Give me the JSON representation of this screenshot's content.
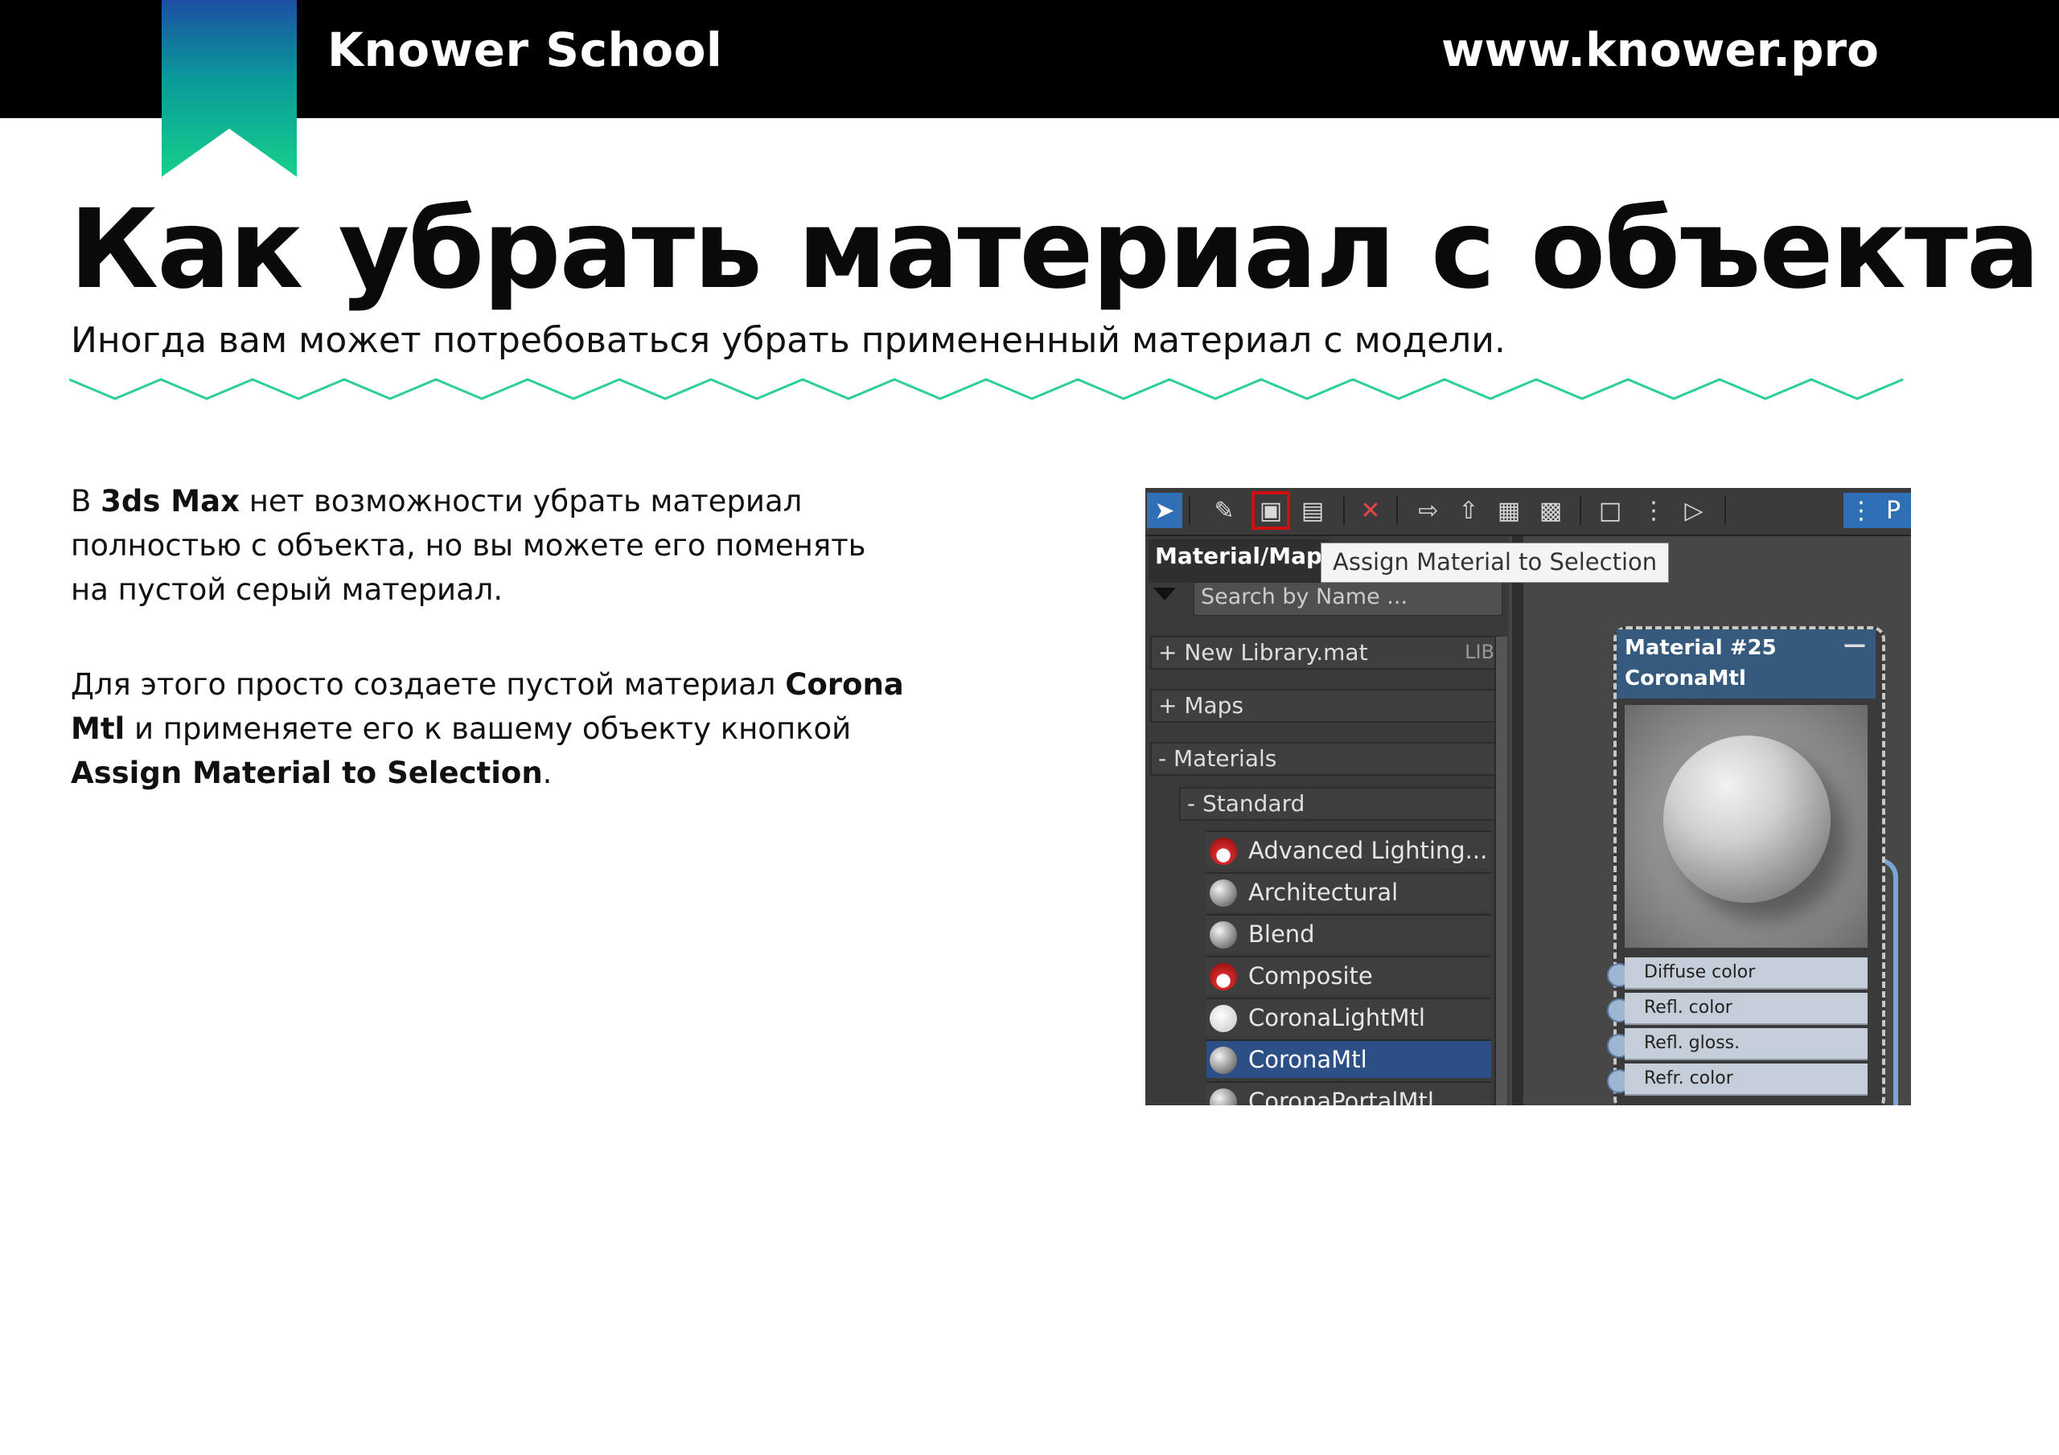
{
  "header": {
    "brand": "Knower School",
    "website": "www.knower.pro"
  },
  "page": {
    "title": "Как убрать материал с объекта",
    "subtitle": "Иногда вам может потребоваться убрать примененный материал с модели."
  },
  "body": {
    "p1": {
      "a": "В ",
      "b1": "3ds Max",
      "c": " нет возможности убрать материал полностью с объекта, но вы можете его поменять на пустой серый материал."
    },
    "p2": {
      "a": "Для этого просто создаете пустой материал ",
      "b1": "Corona Mtl",
      "c": " и применяете его к вашему объекту кнопкой ",
      "b2": "Assign Material to Selection",
      "d": "."
    }
  },
  "screenshot": {
    "tab_label": "Material/Map",
    "tooltip": "Assign Material to Selection",
    "search_placeholder": "Search by Name ...",
    "library": {
      "label": "+ New Library.mat",
      "tag": "LIB"
    },
    "maps": "+ Maps",
    "materials": "- Materials",
    "standard": "- Standard",
    "items": [
      {
        "label": "Advanced Lighting...",
        "icon": "red"
      },
      {
        "label": "Architectural",
        "icon": "grey"
      },
      {
        "label": "Blend",
        "icon": "grey"
      },
      {
        "label": "Composite",
        "icon": "red"
      },
      {
        "label": "CoronaLightMtl",
        "icon": "white"
      },
      {
        "label": "CoronaMtl",
        "icon": "grey",
        "active": true
      },
      {
        "label": "CoronaPortalMtl",
        "icon": "grey"
      }
    ],
    "node": {
      "name": "Material #25",
      "type": "CoronaMtl",
      "slots": [
        "Diffuse color",
        "Refl. color",
        "Refl. gloss.",
        "Refr. color"
      ]
    },
    "toolbar_icons": [
      "select-arrow-icon",
      "eyedropper-icon",
      "assign-material-icon",
      "put-to-scene-icon",
      "delete-icon",
      "move-children-icon",
      "pick-material-icon",
      "show-background-icon",
      "checker-icon",
      "layout-icon",
      "nav-icon",
      "hierarchy-icon",
      "node-select-icon",
      "params-icon"
    ]
  }
}
